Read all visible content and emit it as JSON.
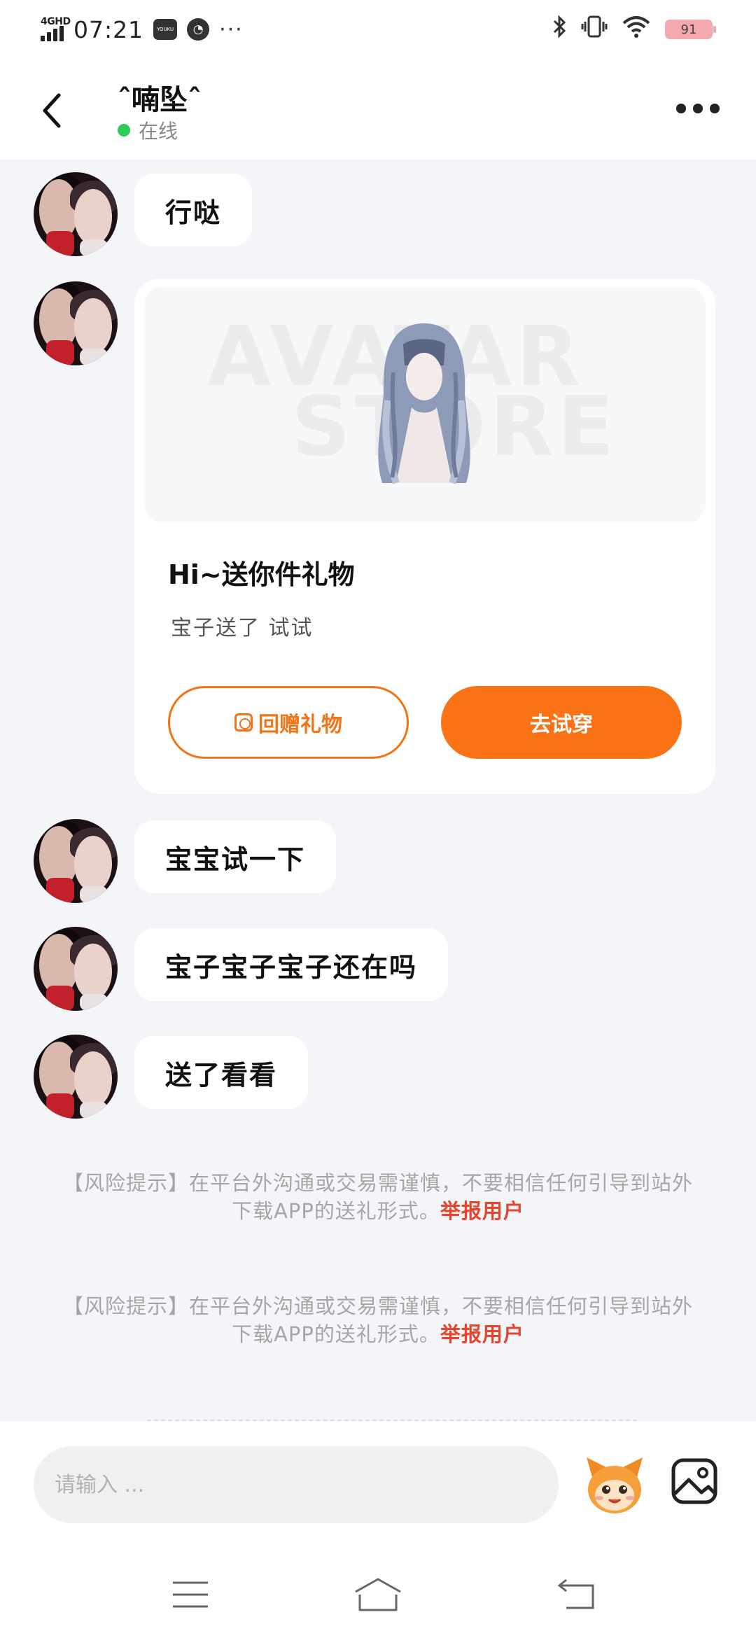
{
  "status_bar": {
    "network": "4GHD",
    "time": "07:21",
    "app_badge": "YOUKU",
    "app2_icon": "gauge-icon",
    "more": "···",
    "battery": "91"
  },
  "header": {
    "title": "ˆ喃坠ˆ",
    "status": "在线",
    "status_color": "#2ecc55"
  },
  "messages": [
    {
      "text": "行哒"
    },
    {
      "type": "gift"
    },
    {
      "text": "宝宝试一下"
    },
    {
      "text": "宝子宝子宝子还在吗"
    },
    {
      "text": "送了看看"
    }
  ],
  "gift_card": {
    "watermark_1": "AVATAR",
    "watermark_2": "STORE",
    "title": "Hi~送你件礼物",
    "subtitle": "宝子送了 试试",
    "return_button": "回赠礼物",
    "try_button": "去试穿",
    "accent_color": "#f97316"
  },
  "notices": [
    {
      "text": "【风险提示】在平台外沟通或交易需谨慎，不要相信任何引导到站外下载APP的送礼形式。",
      "link": "举报用户"
    },
    {
      "text": "【风险提示】在平台外沟通或交易需谨慎，不要相信任何引导到站外下载APP的送礼形式。",
      "link": "举报用户"
    }
  ],
  "input": {
    "placeholder": "请输入 ..."
  }
}
